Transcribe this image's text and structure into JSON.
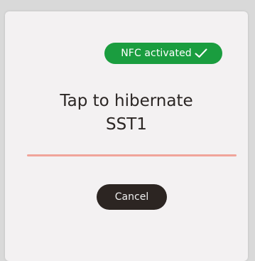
{
  "nfc_badge": {
    "label": "NFC activated",
    "icon": "check-icon",
    "color": "#1a9d3f"
  },
  "title": {
    "line1": "Tap to hibernate",
    "line2": "SST1"
  },
  "divider": {
    "color": "#f0a49a"
  },
  "cancel_button": {
    "label": "Cancel"
  }
}
